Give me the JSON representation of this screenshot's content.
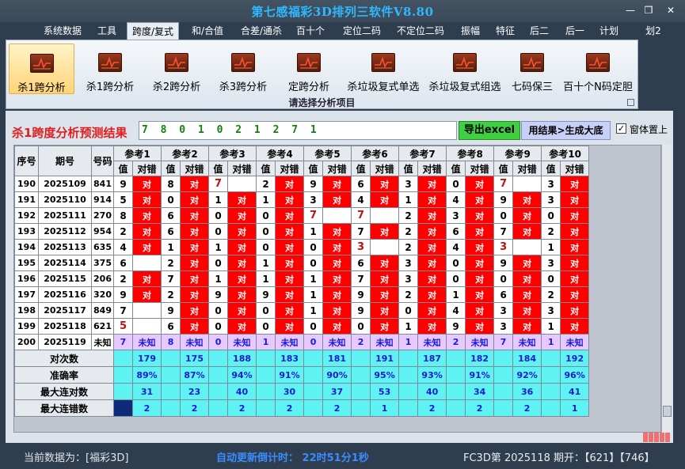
{
  "app": {
    "title": "第七感福彩3D排列三软件V8.80"
  },
  "window_controls": {
    "minimize": "—",
    "restore": "❐",
    "close": "✕"
  },
  "menu": [
    {
      "label": "系统数据"
    },
    {
      "label": "工具"
    },
    {
      "label": "跨度/复式",
      "active": true
    },
    {
      "label": "和/合值"
    },
    {
      "label": "合差/通杀"
    },
    {
      "label": "百十个"
    },
    {
      "label": "定位二码"
    },
    {
      "label": "不定位二码"
    },
    {
      "label": "振幅"
    },
    {
      "label": "特征"
    },
    {
      "label": "后二"
    },
    {
      "label": "后一"
    },
    {
      "label": "计划"
    },
    {
      "label": "划2"
    }
  ],
  "ribbon": {
    "buttons": [
      {
        "label": "杀1跨分析",
        "active": true
      },
      {
        "label": "杀1跨分析"
      },
      {
        "label": "杀2跨分析"
      },
      {
        "label": "杀3跨分析"
      },
      {
        "label": "定跨分析"
      },
      {
        "label": "杀垃圾复式单选"
      },
      {
        "label": "杀垃圾复式组选"
      },
      {
        "label": "七码保三"
      },
      {
        "label": "百十个N码定胆"
      }
    ],
    "caption": "请选择分析项目",
    "icon_name": "chart-icon"
  },
  "result": {
    "label": "杀1跨度分析预测结果",
    "value": "7 8 0 1 0 2 1 2 7 1",
    "export_button": "导出excel",
    "generate_button": "用结果>生成大底",
    "topmost_checked": true,
    "topmost_label": "窗体置上"
  },
  "grid": {
    "headers": {
      "seq": "序号",
      "issue": "期号",
      "number": "号码",
      "value": "值",
      "check": "对错"
    },
    "refs": [
      "参考1",
      "参考2",
      "参考3",
      "参考4",
      "参考5",
      "参考6",
      "参考7",
      "参考8",
      "参考9",
      "参考10"
    ],
    "hit_text": "对",
    "rows": [
      {
        "seq": "190",
        "issue": "2025109",
        "num": "841",
        "vals": [
          9,
          8,
          7,
          2,
          9,
          6,
          3,
          0,
          7,
          3
        ],
        "hits": [
          1,
          1,
          0,
          1,
          1,
          1,
          1,
          1,
          0,
          1
        ],
        "red": [
          0,
          0,
          1,
          0,
          0,
          0,
          0,
          0,
          1,
          0
        ]
      },
      {
        "seq": "191",
        "issue": "2025110",
        "num": "914",
        "vals": [
          5,
          0,
          1,
          1,
          3,
          4,
          1,
          4,
          9,
          3
        ],
        "hits": [
          1,
          1,
          1,
          1,
          1,
          1,
          1,
          1,
          1,
          1
        ],
        "red": [
          0,
          0,
          0,
          0,
          0,
          0,
          0,
          0,
          0,
          0
        ]
      },
      {
        "seq": "192",
        "issue": "2025111",
        "num": "270",
        "vals": [
          8,
          6,
          0,
          0,
          7,
          7,
          2,
          3,
          0,
          0
        ],
        "hits": [
          1,
          1,
          1,
          1,
          0,
          0,
          1,
          1,
          1,
          1
        ],
        "red": [
          0,
          0,
          0,
          0,
          1,
          1,
          0,
          0,
          0,
          0
        ]
      },
      {
        "seq": "193",
        "issue": "2025112",
        "num": "954",
        "vals": [
          2,
          6,
          0,
          0,
          1,
          7,
          2,
          6,
          7,
          2
        ],
        "hits": [
          1,
          1,
          1,
          1,
          1,
          1,
          1,
          1,
          1,
          1
        ],
        "red": [
          0,
          0,
          0,
          0,
          0,
          0,
          0,
          0,
          0,
          0
        ]
      },
      {
        "seq": "194",
        "issue": "2025113",
        "num": "635",
        "vals": [
          4,
          1,
          1,
          0,
          0,
          3,
          2,
          4,
          3,
          1
        ],
        "hits": [
          1,
          1,
          1,
          1,
          1,
          0,
          1,
          1,
          0,
          1
        ],
        "red": [
          0,
          0,
          0,
          0,
          0,
          1,
          0,
          0,
          1,
          0
        ]
      },
      {
        "seq": "195",
        "issue": "2025114",
        "num": "375",
        "vals": [
          6,
          2,
          0,
          1,
          0,
          6,
          3,
          0,
          9,
          3
        ],
        "hits": [
          0,
          1,
          1,
          1,
          1,
          1,
          1,
          1,
          1,
          1
        ],
        "red": [
          0,
          0,
          0,
          0,
          0,
          0,
          0,
          0,
          0,
          0
        ]
      },
      {
        "seq": "196",
        "issue": "2025115",
        "num": "206",
        "vals": [
          2,
          7,
          1,
          1,
          1,
          7,
          3,
          0,
          0,
          0
        ],
        "hits": [
          1,
          1,
          1,
          1,
          1,
          1,
          1,
          1,
          1,
          1
        ],
        "red": [
          0,
          0,
          0,
          0,
          0,
          0,
          0,
          0,
          0,
          0
        ]
      },
      {
        "seq": "197",
        "issue": "2025116",
        "num": "320",
        "vals": [
          9,
          2,
          9,
          9,
          1,
          9,
          2,
          1,
          6,
          2
        ],
        "hits": [
          1,
          1,
          1,
          1,
          1,
          1,
          1,
          1,
          1,
          1
        ],
        "red": [
          0,
          0,
          0,
          0,
          0,
          0,
          0,
          0,
          0,
          0
        ]
      },
      {
        "seq": "198",
        "issue": "2025117",
        "num": "849",
        "vals": [
          7,
          9,
          0,
          0,
          1,
          9,
          0,
          4,
          3,
          3
        ],
        "hits": [
          0,
          1,
          1,
          1,
          1,
          1,
          1,
          1,
          1,
          1
        ],
        "red": [
          0,
          0,
          0,
          0,
          0,
          0,
          0,
          0,
          0,
          0
        ]
      },
      {
        "seq": "199",
        "issue": "2025118",
        "num": "621",
        "vals": [
          5,
          6,
          0,
          0,
          0,
          0,
          1,
          9,
          3,
          1
        ],
        "hits": [
          0,
          1,
          1,
          1,
          1,
          1,
          1,
          1,
          1,
          1
        ],
        "red": [
          1,
          0,
          0,
          0,
          0,
          0,
          0,
          0,
          0,
          0
        ]
      }
    ],
    "pending": {
      "seq": "200",
      "issue": "2025119",
      "num": "未知",
      "vals": [
        7,
        8,
        0,
        1,
        0,
        2,
        1,
        2,
        7,
        1
      ],
      "status": "未知"
    },
    "stats": [
      {
        "label": "对次数",
        "values": [
          "179",
          "175",
          "188",
          "183",
          "181",
          "191",
          "187",
          "182",
          "184",
          "192"
        ]
      },
      {
        "label": "准确率",
        "values": [
          "89%",
          "87%",
          "94%",
          "91%",
          "90%",
          "95%",
          "93%",
          "91%",
          "92%",
          "96%"
        ]
      },
      {
        "label": "最大连对数",
        "values": [
          "31",
          "23",
          "40",
          "30",
          "37",
          "53",
          "40",
          "34",
          "36",
          "41"
        ]
      },
      {
        "label": "最大连错数",
        "values": [
          "2",
          "2",
          "2",
          "2",
          "2",
          "1",
          "2",
          "2",
          "2",
          "1"
        ]
      }
    ]
  },
  "status": {
    "data_source": "当前数据为：[福彩3D]",
    "countdown": "自动更新倒计时：  22时51分1秒",
    "latest": "FC3D第 2025118 期开：【621】【746】"
  },
  "colors": {
    "hit": "#ff0000",
    "stat_bg": "#5ff2f2",
    "pending_bg": "#e7c8ff",
    "title": "#2fb8ff"
  }
}
